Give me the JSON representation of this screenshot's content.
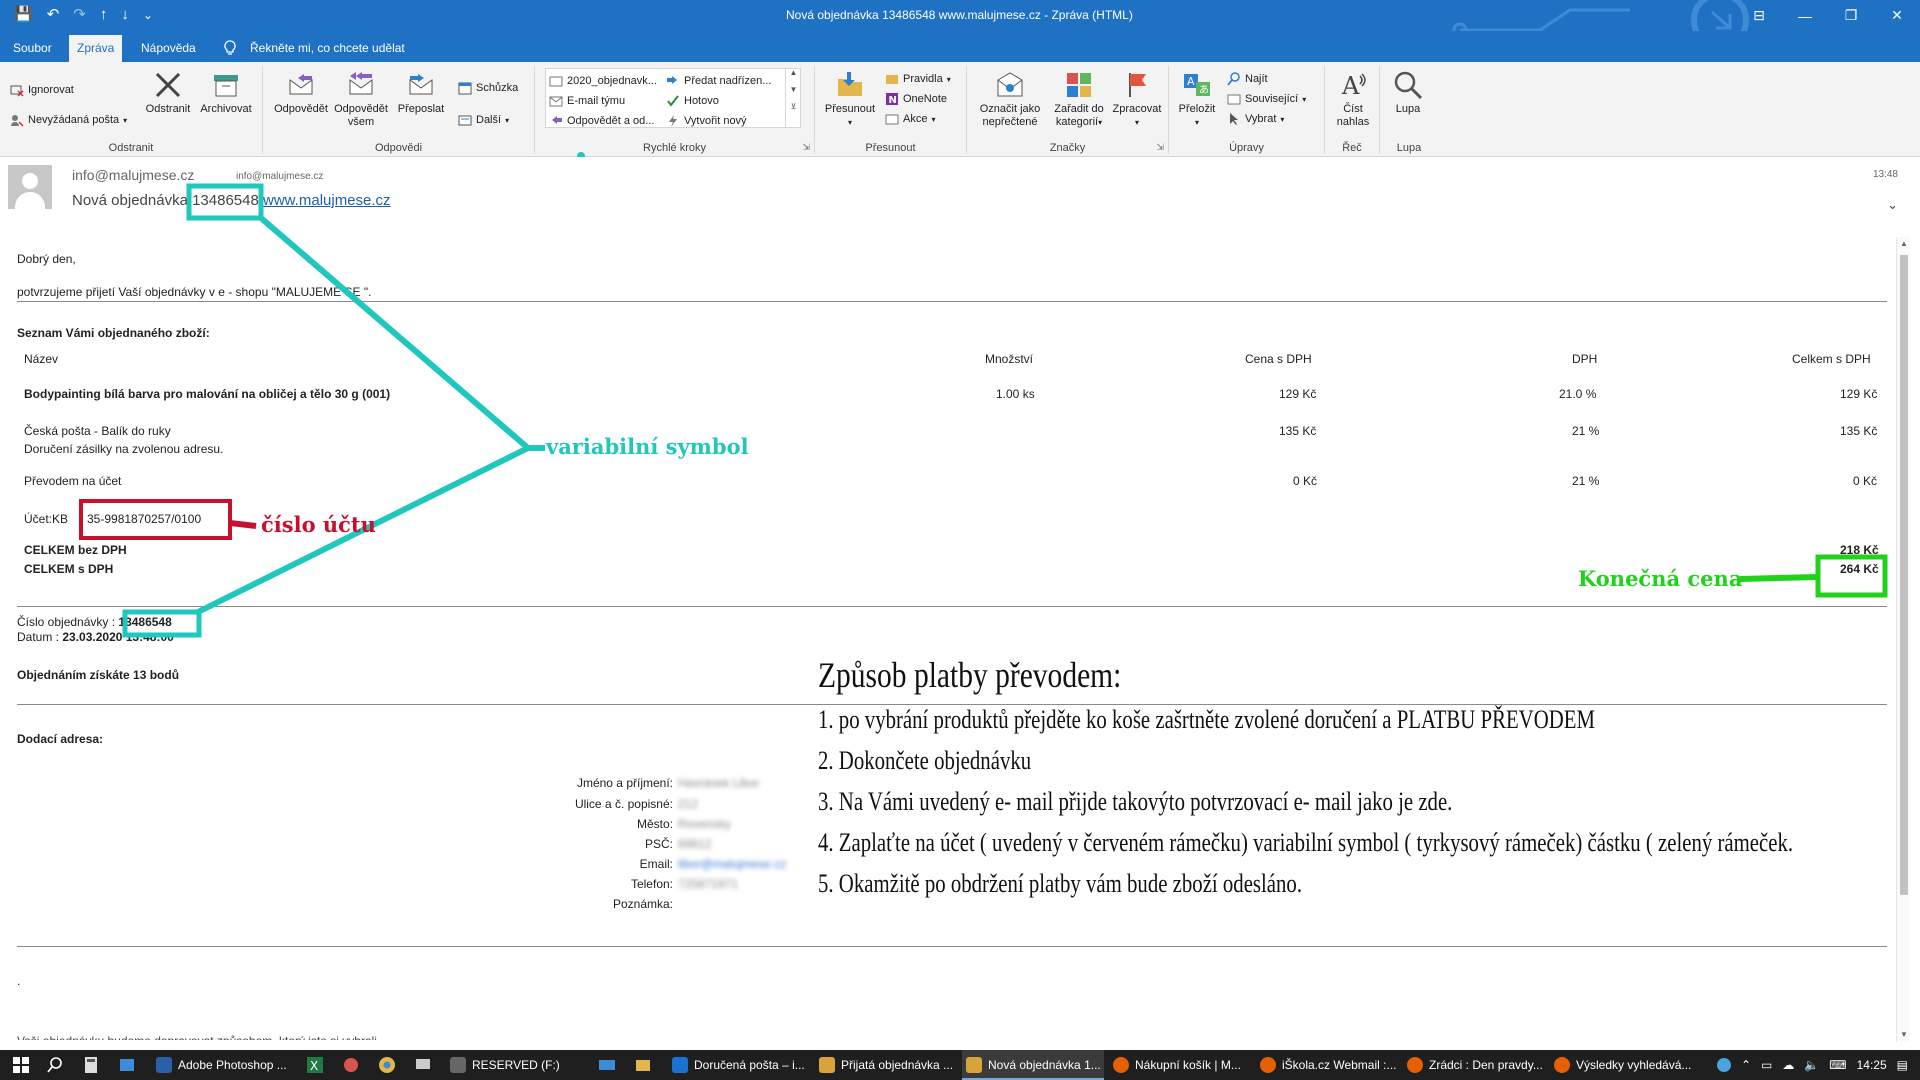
{
  "window": {
    "title": "Nová objednávka 13486548 www.malujmese.cz  -  Zpráva (HTML)",
    "controls": {
      "ribbon_opts": "⊟",
      "minimize": "—",
      "maximize": "❐",
      "close": "✕"
    }
  },
  "qat": {
    "save": "💾",
    "undo": "↶",
    "redo": "↷",
    "up": "↑",
    "down": "↓",
    "more": "⌄"
  },
  "tabs": [
    {
      "label": "Soubor"
    },
    {
      "label": "Zpráva"
    },
    {
      "label": "Nápověda"
    },
    {
      "label": "Řekněte mi, co chcete udělat"
    }
  ],
  "ribbon": {
    "odstranit": {
      "label": "Odstranit",
      "ignore": "Ignorovat",
      "junk": "Nevyžádaná pošta",
      "delete": "Odstranit",
      "archive": "Archivovat"
    },
    "odpovedi": {
      "label": "Odpovědi",
      "reply": "Odpovědět",
      "reply_all_1": "Odpovědět",
      "reply_all_2": "všem",
      "forward": "Přeposlat",
      "meeting": "Schůzka",
      "more": "Další"
    },
    "rychle_kroky": {
      "label": "Rychlé kroky",
      "items": [
        "2020_objednavk...",
        "E-mail týmu",
        "Odpovědět a od...",
        "Předat nadřízen...",
        "Hotovo",
        "Vytvořit nový"
      ]
    },
    "presunout": {
      "label": "Přesunout",
      "move": "Přesunout",
      "rules": "Pravidla",
      "onenote": "OneNote",
      "actions": "Akce"
    },
    "znacky": {
      "label": "Značky",
      "unread_1": "Označit jako",
      "unread_2": "nepřečtené",
      "categorize_1": "Zařadit do",
      "categorize_2": "kategorií",
      "followup": "Zpracovat"
    },
    "upravy": {
      "label": "Úpravy",
      "translate": "Přeložit",
      "find": "Najít",
      "related": "Související",
      "select": "Vybrat"
    },
    "rec": {
      "label": "Řeč",
      "read_1": "Číst",
      "read_2": "nahlas"
    },
    "lupa": {
      "label": "Lupa",
      "zoom": "Lupa"
    }
  },
  "header": {
    "sender": "info@malujmese.cz",
    "sender_small": "info@malujmese.cz",
    "subject_prefix": "Nová objednávka ",
    "order_no": "13486548",
    "subject_link": "www.malujmese.cz",
    "time": "13:48"
  },
  "email": {
    "greeting": "Dobrý den,",
    "intro": "potvrzujeme přijetí Vaší objednávky v e - shopu \"MALUJEME SE \".",
    "list_title": "Seznam Vámi objednaného zboží:",
    "columns": {
      "name": "Název",
      "qty": "Množství",
      "price": "Cena s DPH",
      "vat": "DPH",
      "total": "Celkem s DPH"
    },
    "rows": [
      {
        "name": "Bodypainting bílá barva pro malování na obličej a tělo 30 g (001)",
        "qty": "1.00 ks",
        "price": "129 Kč",
        "vat": "21.0 %",
        "total": "129 Kč"
      },
      {
        "name": "Česká pošta - Balík do ruky",
        "sub": "Doručení zásilky na zvolenou adresu.",
        "price": "135 Kč",
        "vat": "21 %",
        "total": "135 Kč"
      },
      {
        "name": "Převodem na účet",
        "price": "0 Kč",
        "vat": "21 %",
        "total": "0 Kč"
      }
    ],
    "account_label": "Účet:KB",
    "account": "35-9981870257/0100",
    "total_novat_label": "CELKEM bez DPH",
    "total_novat": "218 Kč",
    "total_label": "CELKEM s DPH",
    "total": "264 Kč",
    "order_label": "Číslo objednávky : ",
    "order_no": "13486548",
    "date_label": "Datum : ",
    "date": "23.03.2020 13:48:00",
    "points": "Objednáním získáte 13 bodů",
    "delivery_title": "Dodací adresa:",
    "delivery": [
      {
        "label": "Jméno a příjmení:",
        "value": "Havránek Libor"
      },
      {
        "label": "Ulice a č. popisné:",
        "value": "212"
      },
      {
        "label": "Město:",
        "value": "Rovensky"
      },
      {
        "label": "PSČ:",
        "value": "69612"
      },
      {
        "label": "Email:",
        "value": "libor@malujmese.cz",
        "link": true
      },
      {
        "label": "Telefon:",
        "value": "725871971"
      },
      {
        "label": "Poznámka:",
        "value": ""
      }
    ],
    "dot": ".",
    "cut_line": "Vaši objednávku budeme dopravovat způsobem, který jste si vybrali."
  },
  "annotations": {
    "variable_symbol": "variabilní symbol",
    "account": "číslo účtu",
    "final_price": "Konečná cena",
    "colors": {
      "teal": "#1fc7bd",
      "red": "#c8102e",
      "green": "#22d11c"
    }
  },
  "instructions": {
    "title": "Způsob platby převodem:",
    "steps": [
      "1. po vybrání produktů přejděte ko koše  zašrtněte  zvolené doručení a PLATBU PŘEVODEM",
      "2. Dokončete objednávku",
      "3. Na Vámi uvedený e- mail přijde takovýto potvrzovací e- mail jako je zde.",
      "4. Zaplaťte na účet ( uvedený v červeném rámečku) variabilní symbol ( tyrkysový rámeček) částku ( zelený rámeček.",
      "5. Okamžitě po obdržení platby vám bude zboží odesláno."
    ]
  },
  "taskbar": {
    "apps": [
      {
        "label": "Adobe Photoshop ...",
        "color": "#2b5fa8"
      },
      {
        "label": "RESERVED (F:)",
        "color": "#666"
      },
      {
        "label": "Doručená pošta – i...",
        "color": "#1a73d1"
      },
      {
        "label": "Přijatá objednávka ...",
        "color": "#d8a43a"
      },
      {
        "label": "Nová objednávka 1...",
        "color": "#d8a43a"
      },
      {
        "label": "Nákupní košík | M...",
        "color": "#e66000"
      },
      {
        "label": "iŠkola.cz Webmail :...",
        "color": "#e66000"
      },
      {
        "label": "Zrádci : Den pravdy...",
        "color": "#e66000"
      },
      {
        "label": "Výsledky vyhledává...",
        "color": "#e66000"
      }
    ],
    "time": "14:25"
  }
}
